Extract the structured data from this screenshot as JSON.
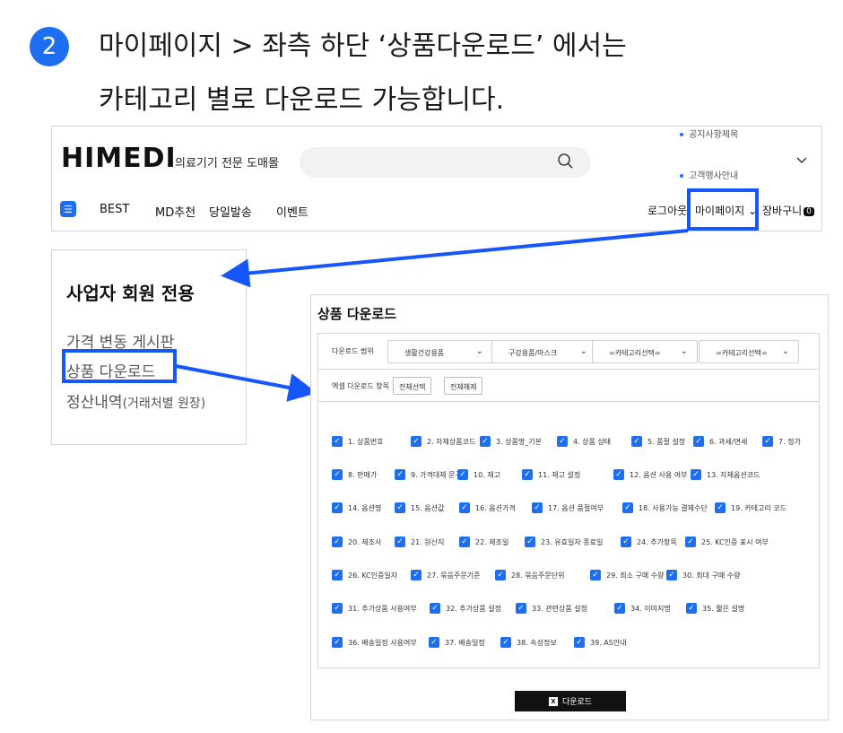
{
  "instruction": {
    "step_number": "2",
    "line1": "마이페이지 > 좌측 하단 ‘상품다운로드’ 에서는",
    "line2": "카테고리 별로 다운로드 가능합니다."
  },
  "site_header": {
    "logo": "HIMEDI",
    "logo_subtitle": "의료기기 전문 도매몰",
    "search_icon": "search-icon",
    "notices": [
      "공지사항제목",
      "고객행사안내"
    ],
    "nav": [
      "BEST",
      "MD추천",
      "당일발송",
      "이벤트"
    ],
    "logout": "로그아웃",
    "mypage": "마이페이지",
    "cart": "장바구니",
    "cart_count": "0"
  },
  "member_panel": {
    "title": "사업자 회원 전용",
    "items": [
      "가격 변동 게시판",
      "상품 다운로드",
      "정산내역"
    ],
    "item3_suffix": "(거래처별 원장)"
  },
  "download_panel": {
    "title": "상품 다운로드",
    "range_label": "다운로드 범위",
    "selects": [
      "생활건강용품",
      "구강용품/마스크",
      "=카테고리선택=",
      "=카테고리선택="
    ],
    "excel_label": "엑셀 다운로드 항목",
    "select_all": "전체선택",
    "deselect_all": "전체해제",
    "checks": [
      [
        "1. 상품번호",
        "2. 자체상품코드",
        "3. 상품명_기본",
        "4. 상품 상태",
        "5. 품절 설정",
        "6. 과세/면세",
        "7. 정가"
      ],
      [
        "8. 판매가",
        "9. 가격대체 문구",
        "10. 재고",
        "11. 재고 설정",
        "12. 옵션 사용 여부",
        "13. 자체옵션코드"
      ],
      [
        "14. 옵션명",
        "15. 옵션값",
        "16. 옵션가격",
        "17. 옵션 품절여부",
        "18. 사용가능 결제수단",
        "19. 카테고리 코드"
      ],
      [
        "20. 제조사",
        "21. 원산지",
        "22. 제조일",
        "23. 유효일자 종료일",
        "24. 추가항목",
        "25. KC인증 표시 여부"
      ],
      [
        "26. KC인증일자",
        "27. 묶음주문기준",
        "28. 묶음주문단위",
        "29. 최소 구매 수량",
        "30. 최대 구매 수량"
      ],
      [
        "31. 추가상품 사용여부",
        "32. 추가상품 설정",
        "33. 관련상품 설정",
        "34. 이미지명",
        "35. 짧은 설명"
      ],
      [
        "36. 배송일정 사용여부",
        "37. 배송일정",
        "38. 속성정보",
        "39. AS안내"
      ]
    ],
    "download_button": "다운로드",
    "excel_icon": "X"
  },
  "colors": {
    "accent": "#1d6ef0",
    "highlight": "#1556ff"
  }
}
